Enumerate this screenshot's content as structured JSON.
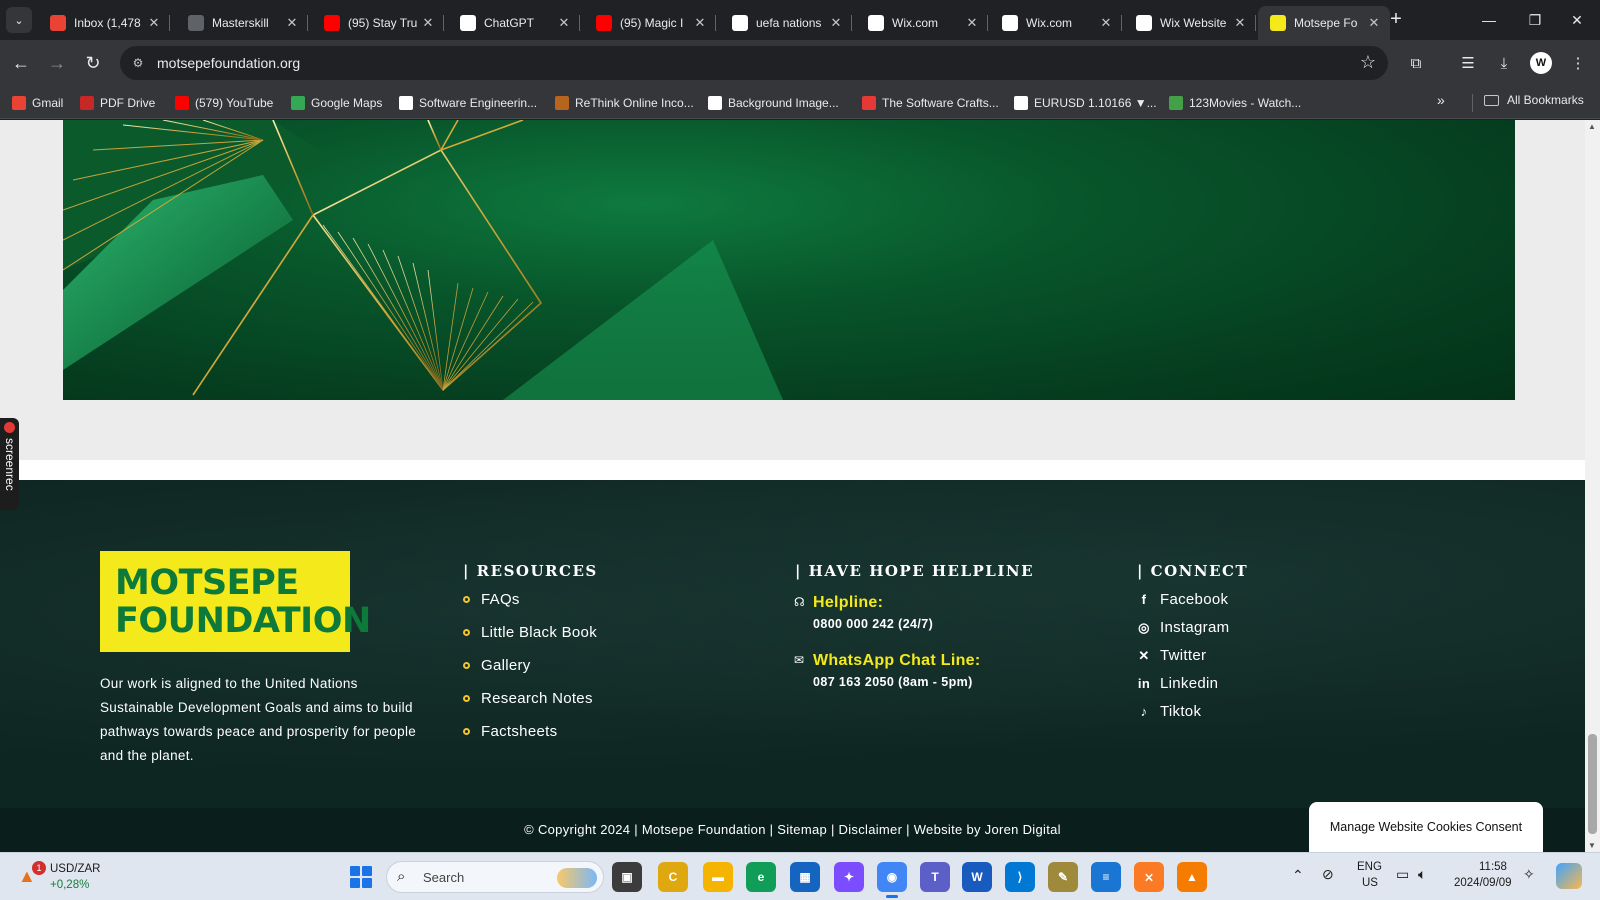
{
  "browser": {
    "tabs": [
      {
        "title": "Inbox (1,478",
        "icon": "gmail-icon",
        "color": "#ea4335"
      },
      {
        "title": "Masterskill",
        "icon": "globe-icon",
        "color": "#5f6368"
      },
      {
        "title": "(95) Stay Tru",
        "icon": "youtube-icon",
        "color": "#ff0000"
      },
      {
        "title": "ChatGPT",
        "icon": "chatgpt-icon",
        "color": "#ffffff"
      },
      {
        "title": "(95) Magic I",
        "icon": "youtube-icon",
        "color": "#ff0000"
      },
      {
        "title": "uefa nations",
        "icon": "google-icon",
        "color": "#ffffff"
      },
      {
        "title": "Wix.com",
        "icon": "wix-icon",
        "color": "#ffffff"
      },
      {
        "title": "Wix.com",
        "icon": "wix-icon",
        "color": "#ffffff"
      },
      {
        "title": "Wix Website",
        "icon": "wix-icon",
        "color": "#ffffff"
      },
      {
        "title": "Motsepe Fo",
        "icon": "motsepe-icon",
        "color": "#f4ea1b",
        "active": true
      }
    ],
    "url": "motsepefoundation.org",
    "bookmarks": [
      {
        "label": "Gmail",
        "icon": "gmail-icon",
        "color": "#ea4335"
      },
      {
        "label": "PDF Drive",
        "icon": "pdfdrive-icon",
        "color": "#c62828"
      },
      {
        "label": "(579) YouTube",
        "icon": "youtube-icon",
        "color": "#ff0000"
      },
      {
        "label": "Google Maps",
        "icon": "maps-icon",
        "color": "#34a853"
      },
      {
        "label": "Software Engineerin...",
        "icon": "bookmark-icon",
        "color": "#ffffff"
      },
      {
        "label": "ReThink Online Inco...",
        "icon": "bookmark-icon",
        "color": "#b5651d"
      },
      {
        "label": "Background Image...",
        "icon": "bookmark-icon",
        "color": "#ffffff"
      },
      {
        "label": "The Software Crafts...",
        "icon": "bookmark-icon",
        "color": "#e53935"
      },
      {
        "label": "EURUSD 1.10166 ▼...",
        "icon": "tradingview-icon",
        "color": "#ffffff"
      },
      {
        "label": "123Movies - Watch...",
        "icon": "play-icon",
        "color": "#43a047"
      }
    ],
    "all_bookmarks": "All Bookmarks"
  },
  "page": {
    "logo": {
      "line1": "MOTSEPE",
      "line2": "FOUNDATION"
    },
    "about": "Our work is aligned to the United Nations Sustainable Development Goals and aims to build pathways towards peace and prosperity for people and the planet.",
    "resources": {
      "heading": "| RESOURCES",
      "items": [
        "FAQs",
        "Little Black Book",
        "Gallery",
        "Research Notes",
        "Factsheets"
      ]
    },
    "helpline": {
      "heading": "| HAVE HOPE HELPLINE",
      "helpline_label": "Helpline:",
      "helpline_value": "0800 000 242 (24/7)",
      "whatsapp_label": "WhatsApp Chat Line:",
      "whatsapp_value": "087 163 2050 (8am - 5pm)"
    },
    "connect": {
      "heading": "| CONNECT",
      "items": [
        {
          "label": "Facebook",
          "icon": "facebook-icon",
          "glyph": "f"
        },
        {
          "label": "Instagram",
          "icon": "instagram-icon",
          "glyph": "◎"
        },
        {
          "label": "Twitter",
          "icon": "x-twitter-icon",
          "glyph": "✕"
        },
        {
          "label": "Linkedin",
          "icon": "linkedin-icon",
          "glyph": "in"
        },
        {
          "label": "Tiktok",
          "icon": "tiktok-icon",
          "glyph": "♪"
        }
      ]
    },
    "copyright": "© Copyright 2024 | Motsepe Foundation | Sitemap | Disclaimer | Website by Joren Digital",
    "cookies": "Manage Website Cookies Consent",
    "screenrec": "screenrec",
    "colors": {
      "brand_yellow": "#f4ea1b",
      "brand_green": "#0d7a3a",
      "footer_bg": "#0e2622",
      "gold": "#d4a93a"
    }
  },
  "taskbar": {
    "stock_name": "USD/ZAR",
    "stock_change": "+0,28%",
    "stock_badge": "1",
    "search_placeholder": "Search",
    "language": "ENG",
    "region": "US",
    "time": "11:58",
    "date": "2024/09/09"
  }
}
